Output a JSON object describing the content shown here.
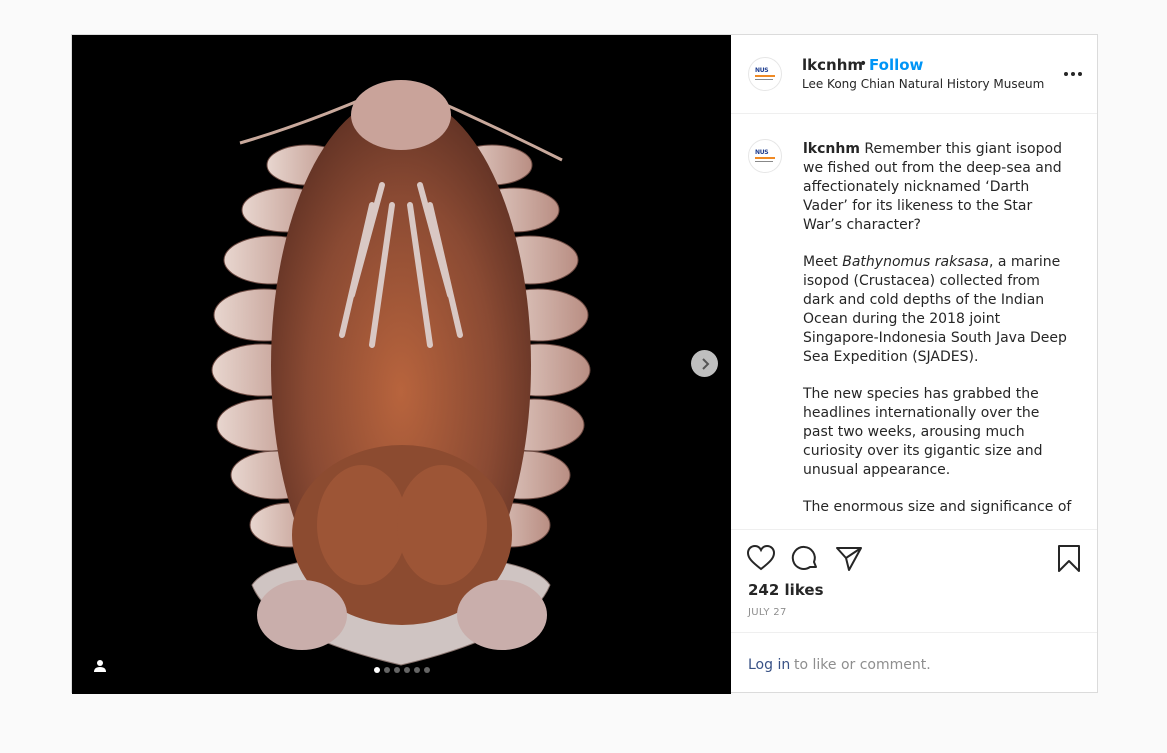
{
  "post": {
    "username": "lkcnhm",
    "separator": "•",
    "follow_label": "Follow",
    "location": "Lee Kong Chian Natural History Museum",
    "avatar_text": "NUS",
    "caption": {
      "username": "lkcnhm",
      "p1": "Remember this giant isopod we fished out from the deep-sea and affectionately nicknamed ‘Darth Vader’ for its likeness to the Star War’s character?",
      "p2_pre": "Meet ",
      "p2_italic": "Bathynomus raksasa",
      "p2_post": ", a marine isopod (Crustacea) collected from dark and cold depths of the Indian Ocean during the 2018 joint Singapore-Indonesia South Java Deep Sea Expedition (SJADES).",
      "p3": "The new species has grabbed the headlines internationally over the past two weeks, arousing much curiosity over its gigantic size and unusual appearance.",
      "p4": "The enormous size and significance of"
    },
    "likes": "242 likes",
    "date": "JULY 27",
    "login_link": "Log in",
    "login_rest": "to like or comment.",
    "carousel": {
      "total": 6,
      "active": 1
    }
  },
  "colors": {
    "accent": "#0095f6",
    "link": "#385185",
    "muted": "#8e8e8e"
  },
  "icons": [
    "heart-icon",
    "comment-icon",
    "share-icon",
    "bookmark-icon",
    "more-icon",
    "chevron-right-icon",
    "user-tag-icon"
  ]
}
